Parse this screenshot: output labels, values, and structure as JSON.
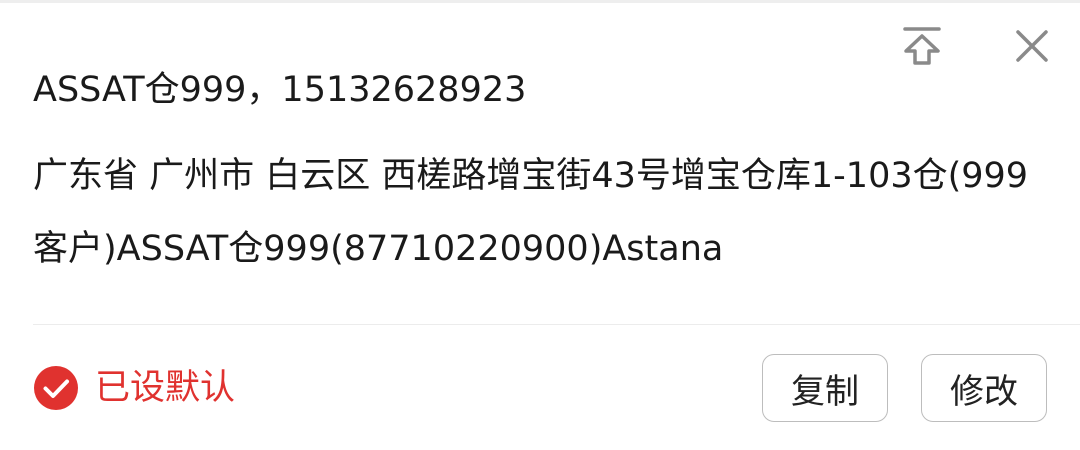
{
  "address_card": {
    "contact_line": "ASSAT仓999，15132628923",
    "address_text": "广东省 广州市 白云区 西槎路增宝街43号增宝仓库1-103仓(999客户)ASSAT仓999(87710220900)Astana",
    "default_label": "已设默认",
    "copy_label": "复制",
    "edit_label": "修改",
    "icons": {
      "pin": "pin-to-top-icon",
      "close": "close-icon",
      "check": "check-circle-icon"
    },
    "colors": {
      "accent": "#e0322f",
      "text": "#1a1a1a",
      "icon_gray": "#8a8a8a"
    }
  }
}
